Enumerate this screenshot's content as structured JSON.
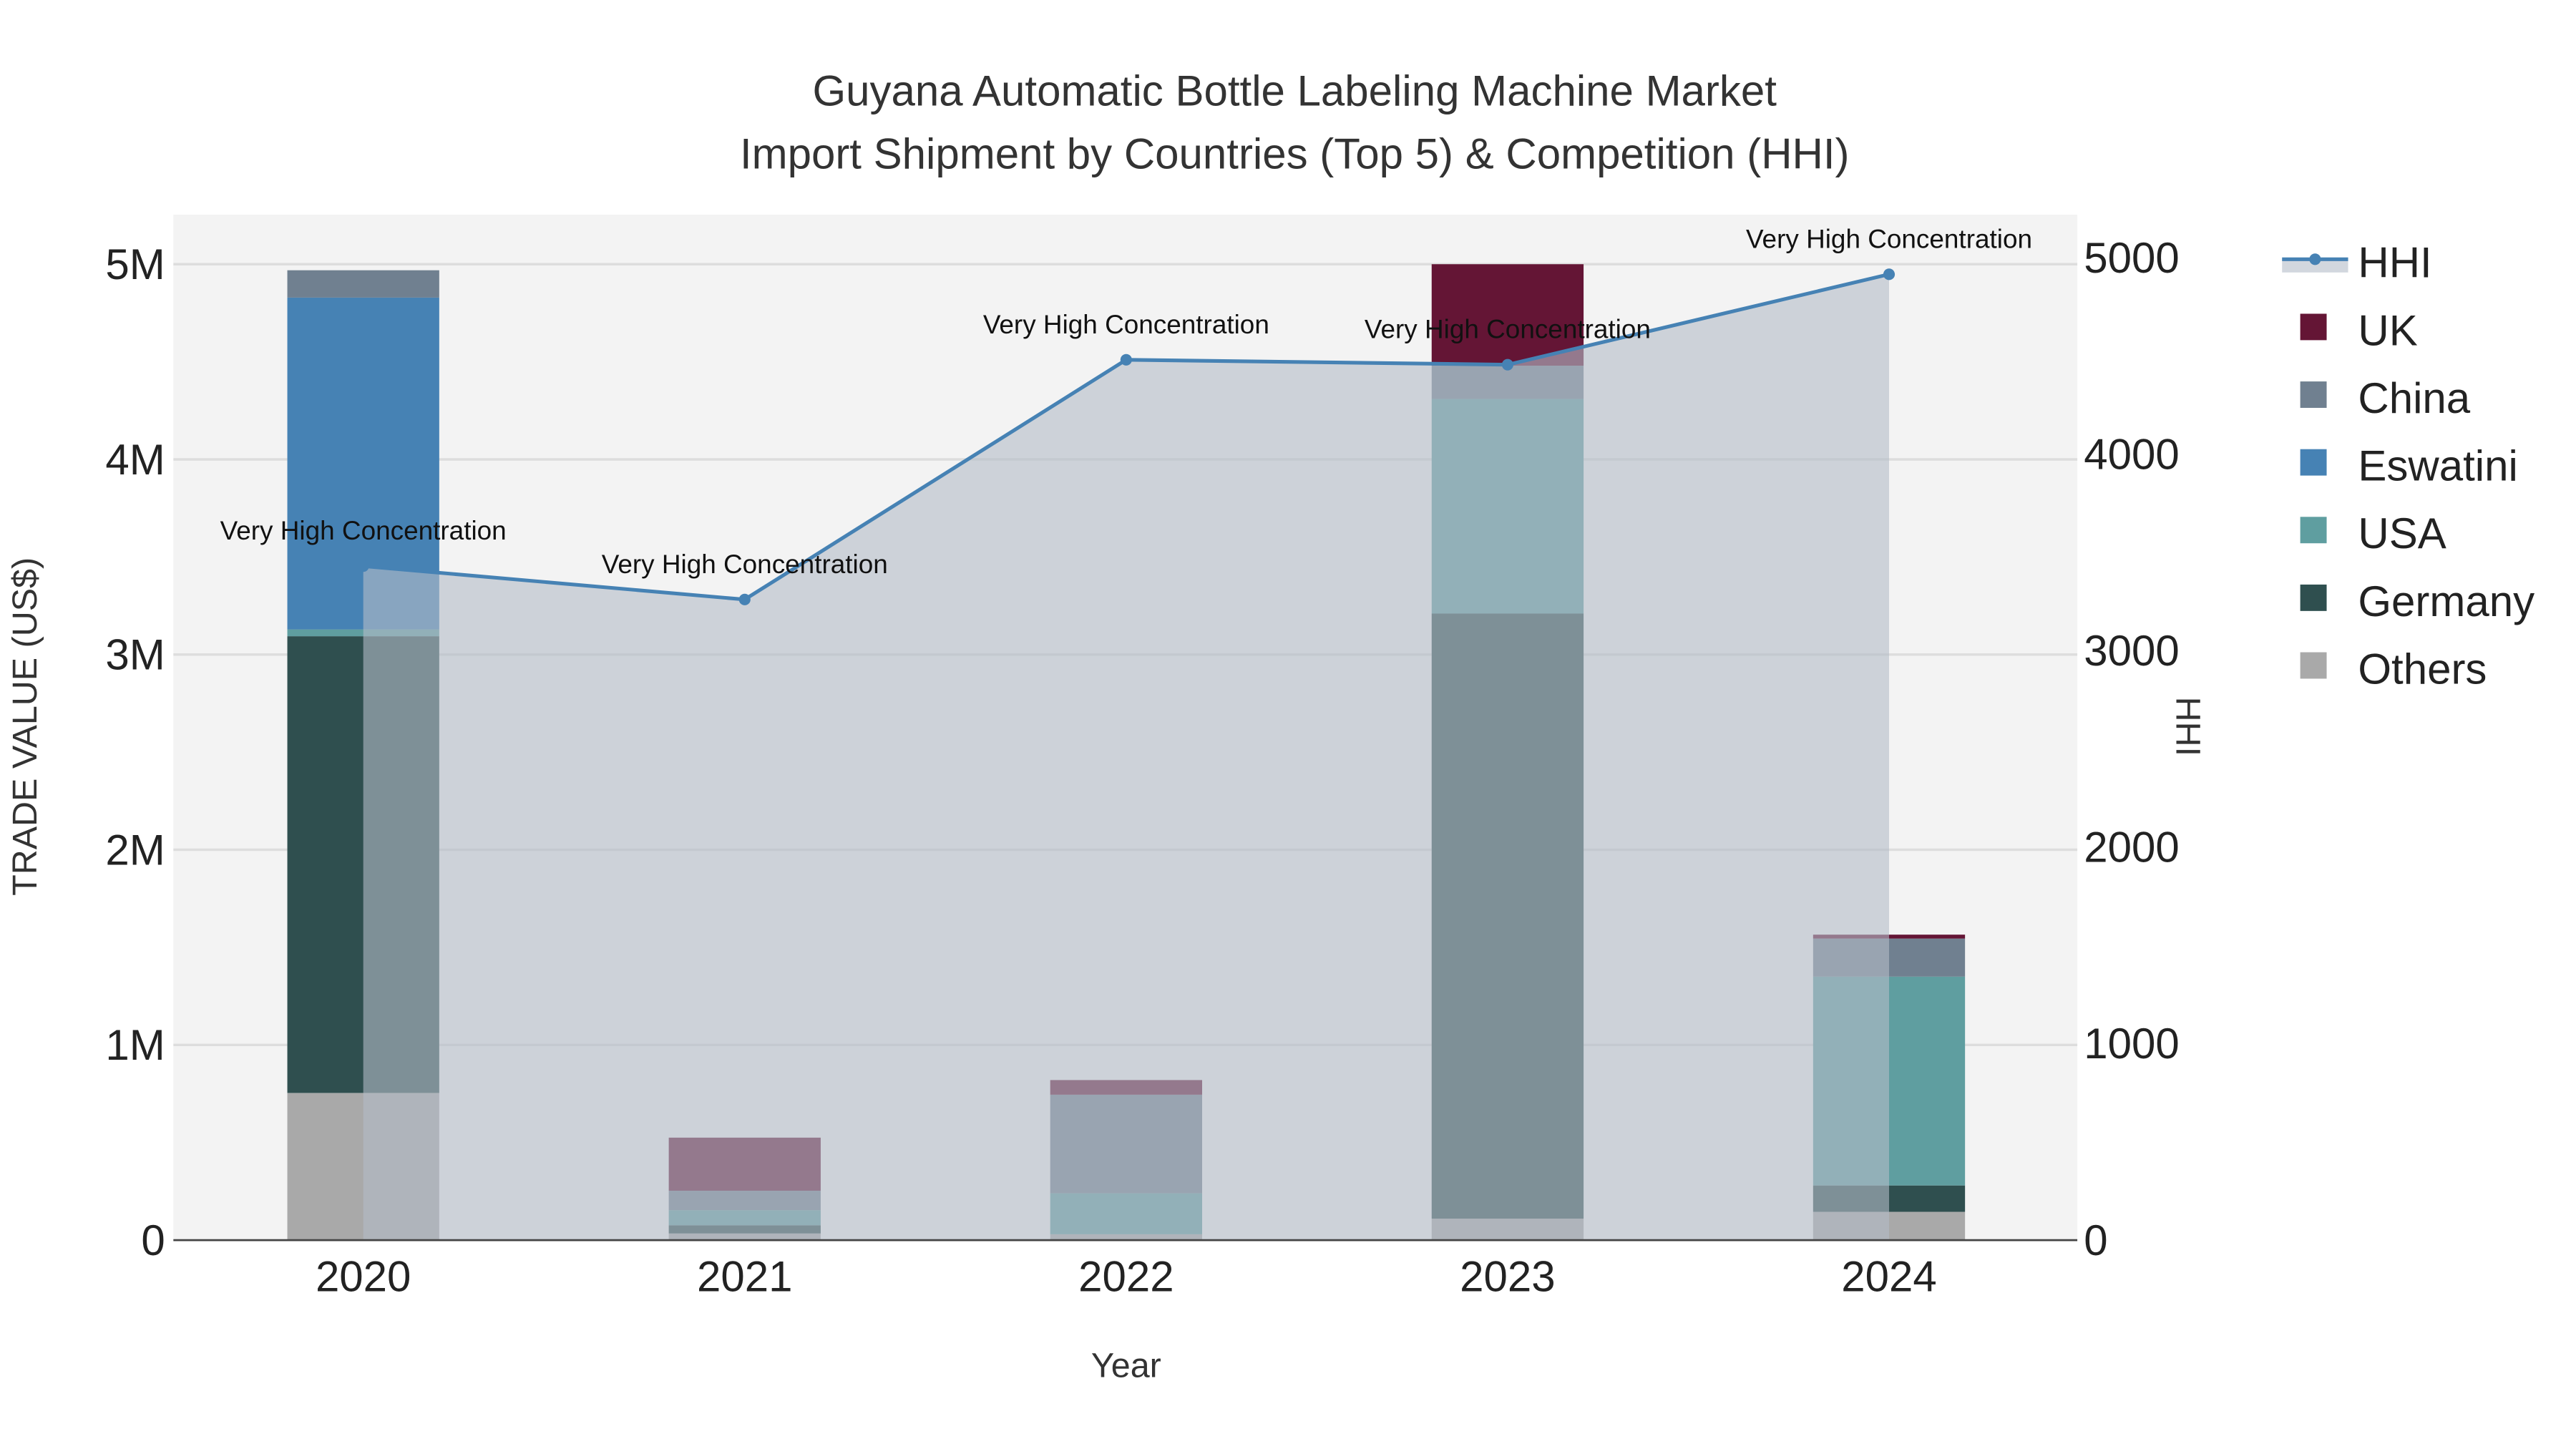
{
  "chart_data": {
    "type": "bar",
    "title": "Guyana Automatic Bottle Labeling Machine Market",
    "subtitle": "Import Shipment by Countries (Top 5) & Competition (HHI)",
    "xlabel": "Year",
    "ylabel": "TRADE VALUE (US$)",
    "y2label": "HHI",
    "categories": [
      "2020",
      "2021",
      "2022",
      "2023",
      "2024"
    ],
    "ylim": [
      0,
      5300000
    ],
    "y2lim": [
      0,
      5200
    ],
    "yticks": [
      {
        "v": 0,
        "label": "0"
      },
      {
        "v": 1000000,
        "label": "1M"
      },
      {
        "v": 2000000,
        "label": "2M"
      },
      {
        "v": 3000000,
        "label": "3M"
      },
      {
        "v": 4000000,
        "label": "4M"
      },
      {
        "v": 5000000,
        "label": "5M"
      }
    ],
    "y2ticks": [
      {
        "v": 0,
        "label": "0"
      },
      {
        "v": 1000,
        "label": "1000"
      },
      {
        "v": 2000,
        "label": "2000"
      },
      {
        "v": 3000,
        "label": "3000"
      },
      {
        "v": 4000,
        "label": "4000"
      },
      {
        "v": 5000,
        "label": "5000"
      }
    ],
    "barmode": "stack",
    "series": [
      {
        "name": "Others",
        "color": "#A9A9A9",
        "values": [
          754000,
          34000,
          30000,
          110000,
          145000
        ]
      },
      {
        "name": "Germany",
        "color": "#2F4F4F",
        "values": [
          2340000,
          42000,
          0,
          3100000,
          135000
        ]
      },
      {
        "name": "USA",
        "color": "#5F9EA0",
        "values": [
          35000,
          77000,
          210000,
          1100000,
          1070000
        ]
      },
      {
        "name": "Eswatini",
        "color": "#4682B4",
        "values": [
          1700000,
          0,
          0,
          0,
          0
        ]
      },
      {
        "name": "China",
        "color": "#708090",
        "values": [
          140000,
          100000,
          505000,
          170000,
          195000
        ]
      },
      {
        "name": "UK",
        "color": "#641535",
        "values": [
          0,
          272000,
          75000,
          520000,
          20000
        ]
      }
    ],
    "line": {
      "name": "HHI",
      "color": "#4682B4",
      "values": [
        3430,
        3260,
        4480,
        4455,
        4915
      ],
      "annotations": [
        "Very High Concentration",
        "Very High Concentration",
        "Very High Concentration",
        "Very High Concentration",
        "Very High Concentration"
      ]
    },
    "legend_order": [
      "HHI",
      "UK",
      "China",
      "Eswatini",
      "USA",
      "Germany",
      "Others"
    ],
    "legend_position": "right",
    "grid": true
  }
}
